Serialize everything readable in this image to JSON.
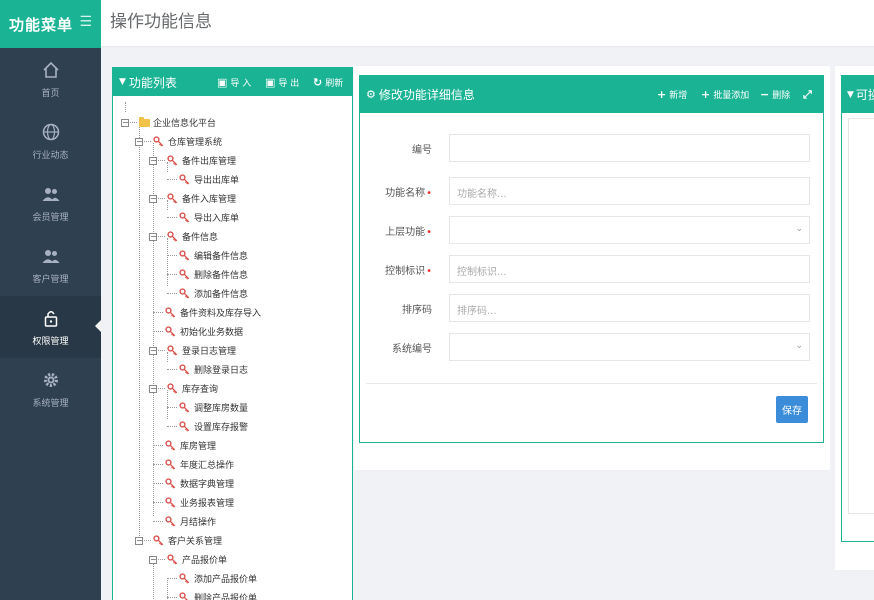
{
  "sidebar": {
    "brand_title": "功能菜单",
    "toggle_icon": "hamburger-icon",
    "items": [
      {
        "label": "首页",
        "icon": "home-icon"
      },
      {
        "label": "行业动态",
        "icon": "globe-icon"
      },
      {
        "label": "会员管理",
        "icon": "users-icon"
      },
      {
        "label": "客户管理",
        "icon": "users-icon"
      },
      {
        "label": "权限管理",
        "icon": "lock-icon",
        "active": true
      },
      {
        "label": "系统管理",
        "icon": "gear-icon"
      }
    ]
  },
  "header": {
    "title": "操作功能信息"
  },
  "function_list": {
    "title": "功能列表",
    "import_label": "导 入",
    "export_label": "导 出",
    "refresh_label": "刷新",
    "tree": [
      "企业信息化平台",
      "仓库管理系统",
      "备件出库管理",
      "导出出库单",
      "备件入库管理",
      "导出入库单",
      "备件信息",
      "编辑备件信息",
      "删除备件信息",
      "添加备件信息",
      "备件资料及库存导入",
      "初始化业务数据",
      "登录日志管理",
      "删除登录日志",
      "库存查询",
      "调整库房数量",
      "设置库存报警",
      "库房管理",
      "年度汇总操作",
      "数据字典管理",
      "业务报表管理",
      "月结操作",
      "客户关系管理",
      "产品报价单",
      "添加产品报价单",
      "删除产品报价单"
    ]
  },
  "detail": {
    "title": "修改功能详细信息",
    "add_label": "新增",
    "batch_add_label": "批量添加",
    "delete_label": "删除",
    "fields": {
      "code_label": "编号",
      "name_label": "功能名称",
      "name_placeholder": "功能名称...",
      "parent_label": "上层功能",
      "control_label": "控制标识",
      "control_placeholder": "控制标识...",
      "sort_label": "排序码",
      "sort_placeholder": "排序码...",
      "system_label": "系统编号"
    },
    "save_label": "保存"
  },
  "right_panel": {
    "title": "可操"
  },
  "colors": {
    "accent": "#1ab394",
    "sidebar": "#2f4050",
    "save": "#3c8dd9"
  }
}
